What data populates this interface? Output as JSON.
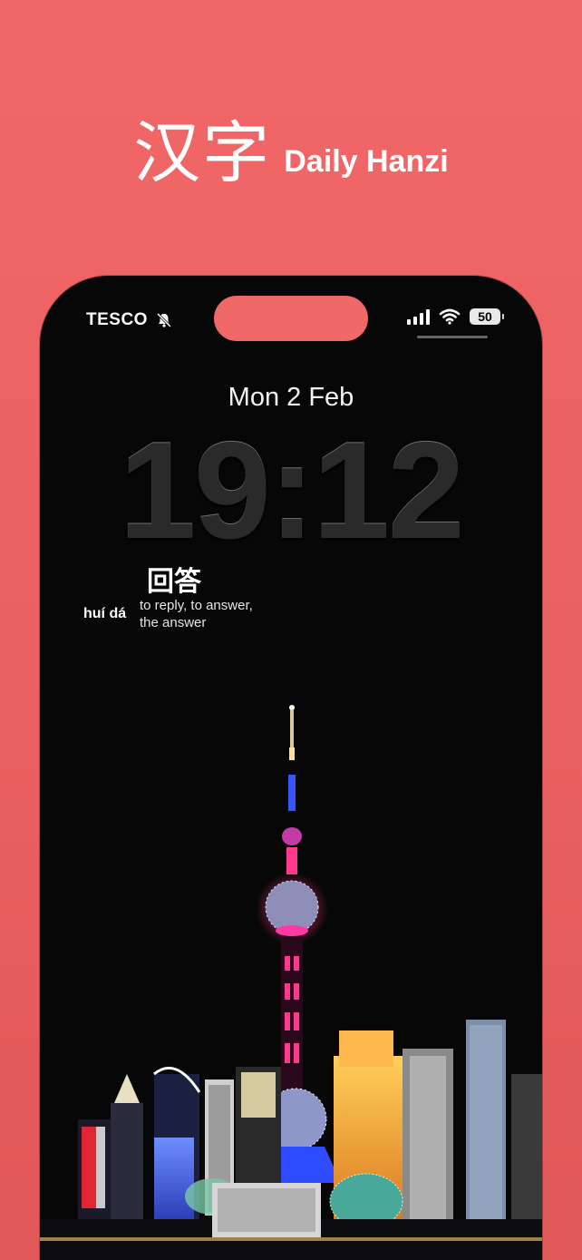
{
  "header": {
    "hanzi": "汉字",
    "app_name": "Daily Hanzi"
  },
  "status_bar": {
    "carrier": "TESCO",
    "battery": "50",
    "icons": [
      "bell-slash-icon",
      "signal-icon",
      "wifi-icon",
      "battery-icon"
    ]
  },
  "lock_screen": {
    "date": "Mon 2 Feb",
    "time": "19:12"
  },
  "widget": {
    "hanzi": "回答",
    "pinyin": "huí dá",
    "meaning_line1": "to reply, to answer,",
    "meaning_line2": "the answer"
  },
  "colors": {
    "background": "#ee6565",
    "phone": "#070707",
    "tower_pink": "#ff2e8a",
    "tower_blue": "#3a6bff"
  }
}
